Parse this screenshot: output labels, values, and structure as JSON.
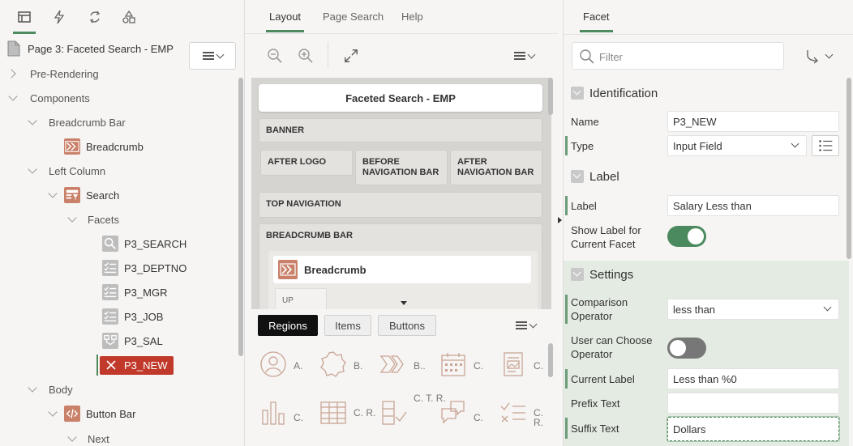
{
  "left": {
    "page_title": "Page 3: Faceted Search - EMP",
    "tree": {
      "pre_rendering": "Pre-Rendering",
      "components": "Components",
      "breadcrumb_bar": "Breadcrumb Bar",
      "breadcrumb": "Breadcrumb",
      "left_column": "Left Column",
      "search": "Search",
      "facets": "Facets",
      "facet_items": [
        "P3_SEARCH",
        "P3_DEPTNO",
        "P3_MGR",
        "P3_JOB",
        "P3_SAL",
        "P3_NEW"
      ],
      "body": "Body",
      "button_bar": "Button Bar",
      "next": "Next"
    }
  },
  "middle": {
    "tabs": [
      "Layout",
      "Page Search",
      "Help"
    ],
    "layout_title": "Faceted Search - EMP",
    "zones": {
      "banner": "BANNER",
      "after_logo": "AFTER LOGO",
      "before_nav": "BEFORE NAVIGATION BAR",
      "after_nav": "AFTER NAVIGATION BAR",
      "top_nav": "TOP NAVIGATION",
      "breadcrumb_bar": "BREADCRUMB BAR",
      "breadcrumb": "Breadcrumb",
      "up": "UP"
    },
    "gallery_tabs": [
      "Regions",
      "Items",
      "Buttons"
    ],
    "gallery_labels": [
      "A.",
      "B.",
      "B..",
      "C.",
      "C.",
      "C.",
      "C. R.",
      "C. T. R.",
      "C.",
      "C. R."
    ]
  },
  "right": {
    "tab": "Facet",
    "filter_placeholder": "Filter",
    "sections": {
      "identification": "Identification",
      "label": "Label",
      "settings": "Settings"
    },
    "props": {
      "name_label": "Name",
      "name_value": "P3_NEW",
      "type_label": "Type",
      "type_value": "Input Field",
      "label_label": "Label",
      "label_value": "Salary Less than",
      "show_label": "Show Label for Current Facet",
      "comparison_label": "Comparison Operator",
      "comparison_value": "less than",
      "user_choose_label": "User can Choose Operator",
      "current_label_label": "Current Label",
      "current_label_value": "Less than %0",
      "prefix_label": "Prefix Text",
      "prefix_value": "",
      "suffix_label": "Suffix Text",
      "suffix_value": "Dollars"
    },
    "toggles": {
      "show_label_on": true,
      "user_choose_on": false
    }
  },
  "colors": {
    "accent": "#4e8a5d",
    "selected": "#c0392b",
    "icon_orange": "#c9816a"
  }
}
